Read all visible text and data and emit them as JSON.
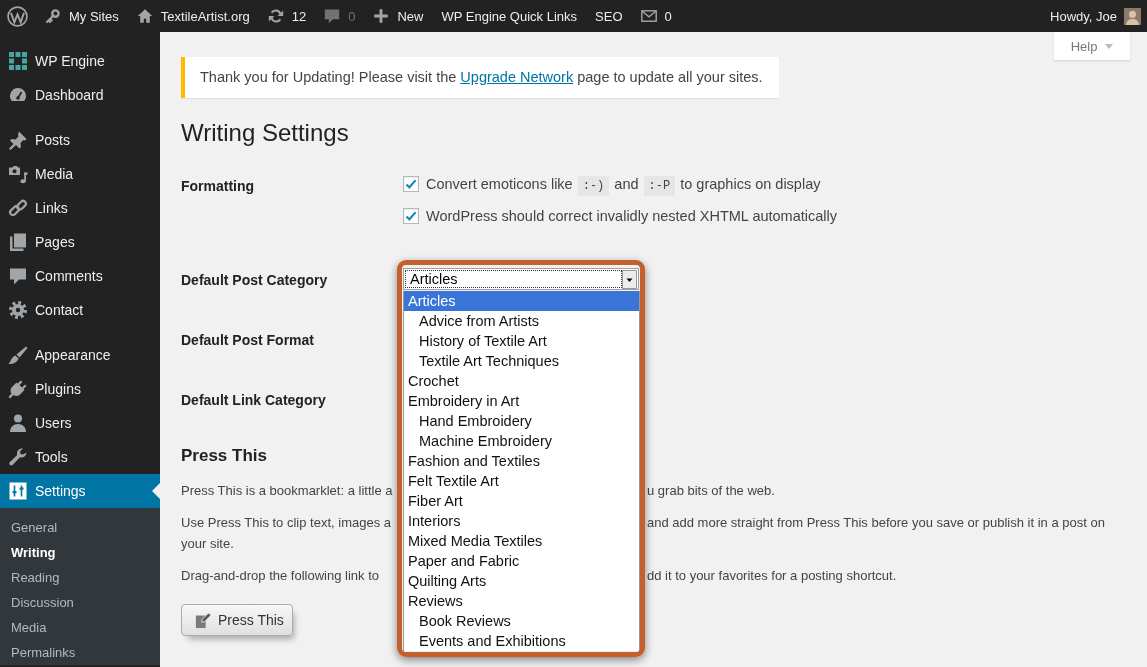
{
  "admin_bar": {
    "items": [
      {
        "label": "My Sites",
        "muted": false
      },
      {
        "label": "TextileArtist.org",
        "muted": false
      },
      {
        "label": "12",
        "muted": false
      },
      {
        "label": "0",
        "muted": true
      },
      {
        "label": "New",
        "muted": false
      },
      {
        "label": "WP Engine Quick Links",
        "muted": false
      },
      {
        "label": "SEO",
        "muted": false
      },
      {
        "label": "0",
        "muted": false
      }
    ],
    "account": "Howdy, Joe"
  },
  "sidebar": {
    "groups": [
      {
        "items": [
          {
            "label": "WP Engine",
            "selected": false
          },
          {
            "label": "Dashboard",
            "selected": false
          }
        ]
      },
      {
        "items": [
          {
            "label": "Posts",
            "selected": false
          },
          {
            "label": "Media",
            "selected": false
          },
          {
            "label": "Links",
            "selected": false
          },
          {
            "label": "Pages",
            "selected": false
          },
          {
            "label": "Comments",
            "selected": false
          },
          {
            "label": "Contact",
            "selected": false
          }
        ]
      },
      {
        "items": [
          {
            "label": "Appearance",
            "selected": false
          },
          {
            "label": "Plugins",
            "selected": false
          },
          {
            "label": "Users",
            "selected": false
          },
          {
            "label": "Tools",
            "selected": false
          },
          {
            "label": "Settings",
            "selected": true,
            "children": [
              {
                "label": "General",
                "selected": false
              },
              {
                "label": "Writing",
                "selected": true
              },
              {
                "label": "Reading",
                "selected": false
              },
              {
                "label": "Discussion",
                "selected": false
              },
              {
                "label": "Media",
                "selected": false
              },
              {
                "label": "Permalinks",
                "selected": false
              }
            ]
          }
        ]
      }
    ]
  },
  "help_tab": {
    "label": "Help"
  },
  "notice": {
    "text_before": "Thank you for Updating! Please visit the",
    "link": "Upgrade Network",
    "text_after": "page to update all your sites."
  },
  "page_title": "Writing Settings",
  "settings": [
    {
      "kind": "checkboxes",
      "label": "Formatting",
      "options": [
        {
          "checked": true,
          "parts": [
            {
              "kind": "text",
              "text": "Convert emoticons like"
            },
            {
              "kind": "code",
              "text": ":-)"
            },
            {
              "kind": "text",
              "text": "and"
            },
            {
              "kind": "code",
              "text": ":-P"
            },
            {
              "kind": "text",
              "text": "to graphics on display"
            }
          ]
        },
        {
          "checked": true,
          "parts": [
            {
              "kind": "text",
              "text": "WordPress should correct invalidly nested XHTML automatically"
            }
          ]
        }
      ]
    },
    {
      "kind": "select",
      "label": "Default Post Category",
      "value": "Articles",
      "expanded": true,
      "options": [
        {
          "label": "Articles",
          "selected": true,
          "children": [
            {
              "label": "Advice from Artists",
              "selected": false
            },
            {
              "label": "History of Textile Art",
              "selected": false
            },
            {
              "label": "Textile Art Techniques",
              "selected": false
            }
          ]
        },
        {
          "label": "Crochet",
          "selected": false
        },
        {
          "label": "Embroidery in Art",
          "selected": false,
          "children": [
            {
              "label": "Hand Embroidery",
              "selected": false
            },
            {
              "label": "Machine Embroidery",
              "selected": false
            }
          ]
        },
        {
          "label": "Fashion and Textiles",
          "selected": false
        },
        {
          "label": "Felt Textile Art",
          "selected": false
        },
        {
          "label": "Fiber Art",
          "selected": false
        },
        {
          "label": "Interiors",
          "selected": false
        },
        {
          "label": "Mixed Media Textiles",
          "selected": false
        },
        {
          "label": "Paper and Fabric",
          "selected": false
        },
        {
          "label": "Quilting Arts",
          "selected": false
        },
        {
          "label": "Reviews",
          "selected": false,
          "children": [
            {
              "label": "Book Reviews",
              "selected": false
            },
            {
              "label": "Events and Exhibitions",
              "selected": false
            }
          ]
        }
      ]
    },
    {
      "kind": "label",
      "label": "Default Post Format"
    },
    {
      "kind": "label",
      "label": "Default Link Category"
    }
  ],
  "press_this": {
    "title": "Press This",
    "paragraphs": [
      {
        "lines": [
          {
            "left": "Press This is a bookmarklet: a little a",
            "right": "u grab bits of the web."
          }
        ]
      },
      {
        "lines": [
          {
            "left": "Use Press This to clip text, images a",
            "right": "and add more straight from Press This before you save or publish it in a post on"
          },
          {
            "left": "your site."
          }
        ]
      },
      {
        "lines": [
          {
            "left": "Drag-and-drop the following link to",
            "right": "dd it to your favorites for a posting shortcut."
          }
        ]
      }
    ],
    "button": "Press This"
  }
}
